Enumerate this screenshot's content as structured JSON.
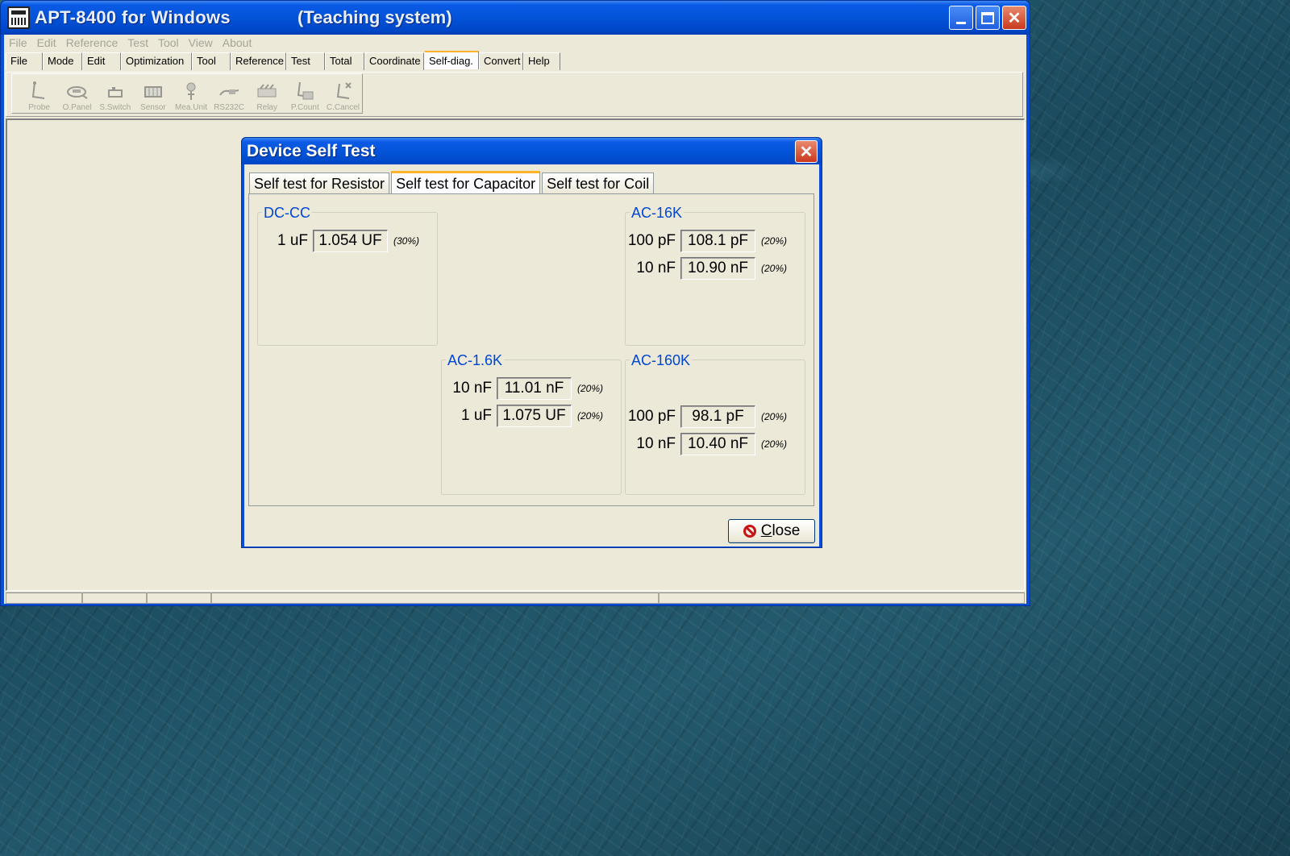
{
  "window": {
    "title": "APT-8400 for Windows",
    "subtitle": "(Teaching system)",
    "controls": {
      "minimize": "_",
      "maximize": "□",
      "close": "✕"
    }
  },
  "menubar": [
    "File",
    "Edit",
    "Reference",
    "Test",
    "Tool",
    "View",
    "About"
  ],
  "tabs": [
    "File",
    "Mode",
    "Edit",
    "Optimization",
    "Tool",
    "Reference",
    "Test",
    "Total",
    "Coordinate",
    "Self-diag.",
    "Convert",
    "Help"
  ],
  "active_tab": "Self-diag.",
  "toolbar": [
    {
      "label": "Probe",
      "icon": "probe-icon"
    },
    {
      "label": "O.Panel",
      "icon": "operation-panel-icon"
    },
    {
      "label": "S.Switch",
      "icon": "switch-icon"
    },
    {
      "label": "Sensor",
      "icon": "sensor-icon"
    },
    {
      "label": "Mea.Unit",
      "icon": "measurement-unit-icon"
    },
    {
      "label": "RS232C",
      "icon": "serial-port-icon"
    },
    {
      "label": "Relay",
      "icon": "relay-icon"
    },
    {
      "label": "P.Count",
      "icon": "probe-count-icon"
    },
    {
      "label": "C.Cancel",
      "icon": "count-cancel-icon"
    }
  ],
  "dialog": {
    "title": "Device Self Test",
    "close_icon": "✕",
    "tabs": [
      "Self test for Resistor",
      "Self test for Capacitor",
      "Self test for Coil"
    ],
    "active_tab": "Self test for Capacitor",
    "groups": {
      "dc_cc": {
        "title": "DC-CC",
        "rows": [
          {
            "label": "1 uF",
            "value": "1.054 UF",
            "tolerance": "(30%)"
          }
        ]
      },
      "ac_16k": {
        "title": "AC-16K",
        "rows": [
          {
            "label": "100 pF",
            "value": "108.1 pF",
            "tolerance": "(20%)"
          },
          {
            "label": "10 nF",
            "value": "10.90 nF",
            "tolerance": "(20%)"
          }
        ]
      },
      "ac_1_6k": {
        "title": "AC-1.6K",
        "rows": [
          {
            "label": "10 nF",
            "value": "11.01 nF",
            "tolerance": "(20%)"
          },
          {
            "label": "1 uF",
            "value": "1.075 UF",
            "tolerance": "(20%)"
          }
        ]
      },
      "ac_160k": {
        "title": "AC-160K",
        "rows": [
          {
            "label": "100 pF",
            "value": "98.1 pF",
            "tolerance": "(20%)"
          },
          {
            "label": "10 nF",
            "value": "10.40 nF",
            "tolerance": "(20%)"
          }
        ]
      }
    },
    "close_button": {
      "label_underlined": "C",
      "label_rest": "lose"
    }
  }
}
